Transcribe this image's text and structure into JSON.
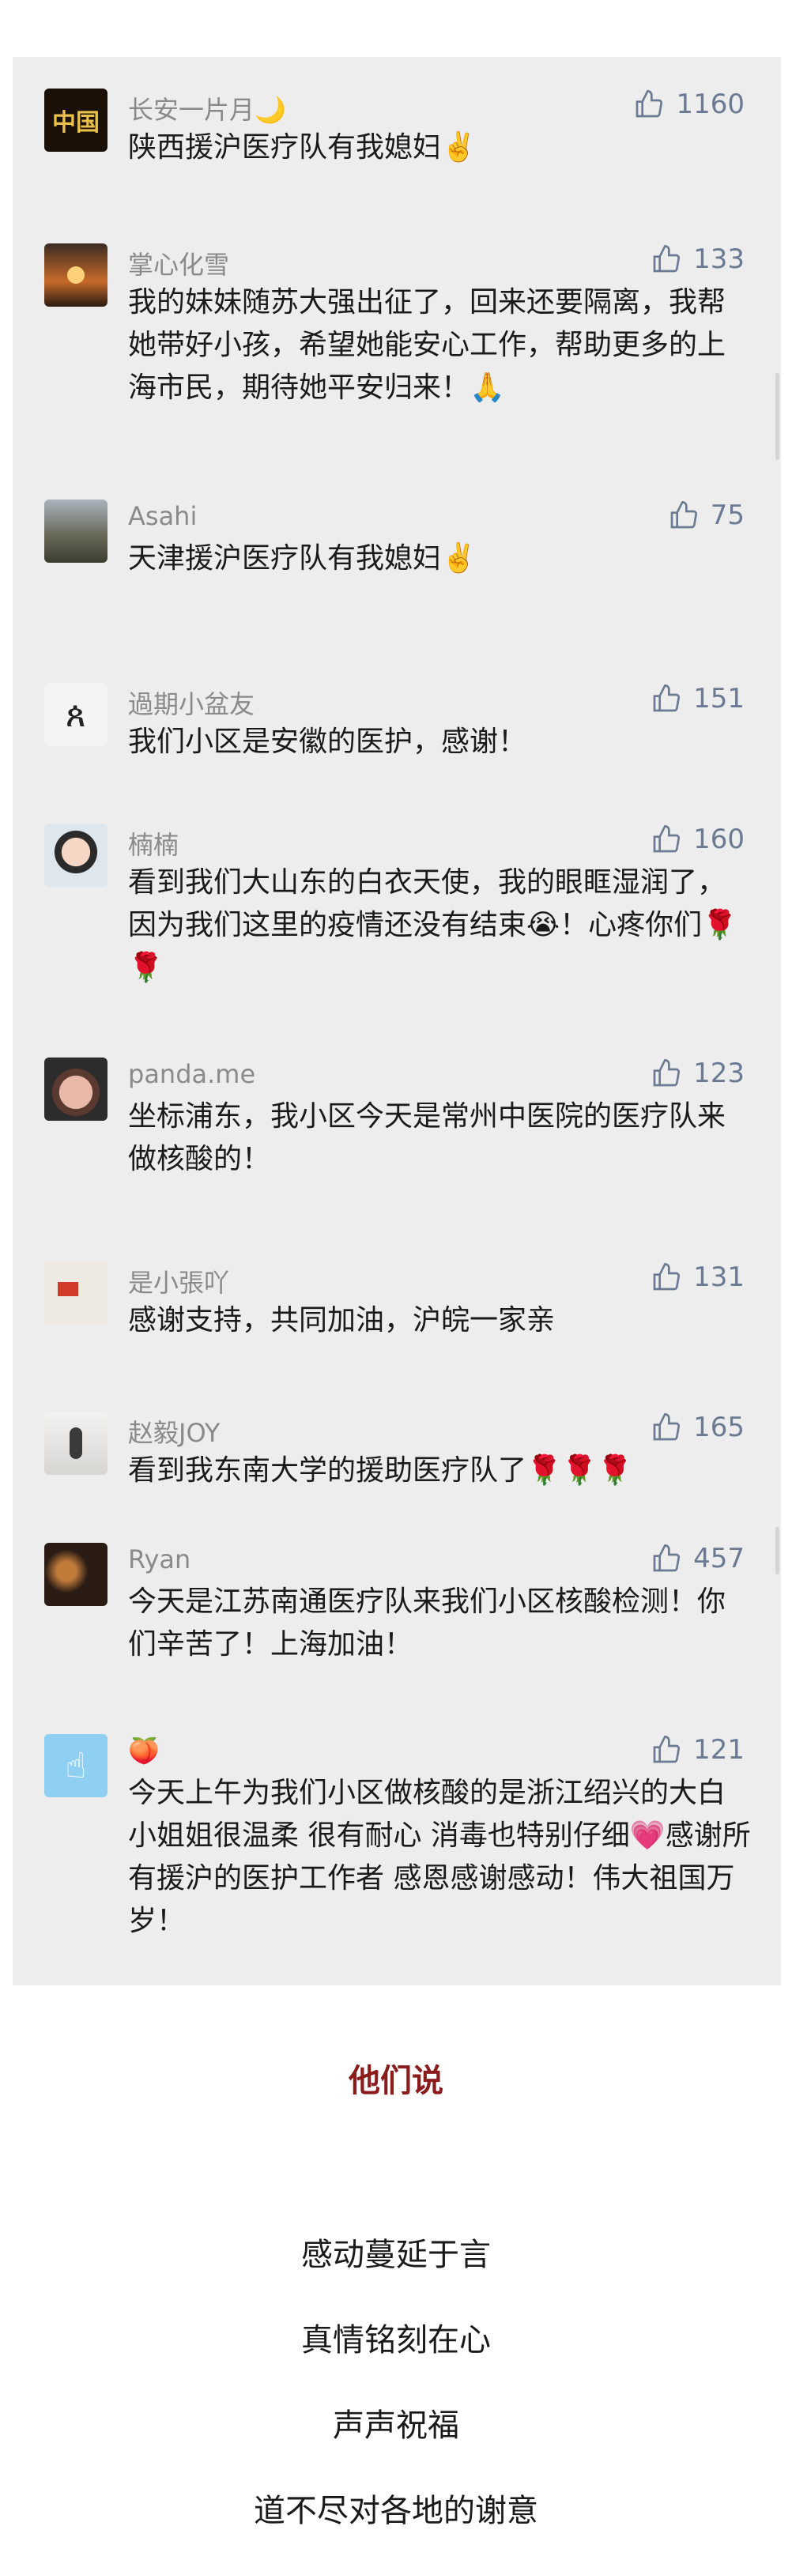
{
  "comments": [
    {
      "user": "长安一片月🌙",
      "likes": "1160",
      "text": "陕西援沪医疗队有我媳妇✌️",
      "avatar_icon": "china-poster-icon"
    },
    {
      "user": "掌心化雪",
      "likes": "133",
      "text": "我的妹妹随苏大强出征了，回来还要隔离，我帮她带好小孩，希望她能安心工作，帮助更多的上海市民，期待她平安归来！🙏",
      "avatar_icon": "sunset-icon"
    },
    {
      "user": "Asahi",
      "likes": "75",
      "text": "天津援沪医疗队有我媳妇✌️",
      "avatar_icon": "building-photo-icon"
    },
    {
      "user": "過期小盆友",
      "likes": "151",
      "text": "我们小区是安徽的医护，感谢！",
      "avatar_icon": "sketch-figure-icon"
    },
    {
      "user": "楠楠",
      "likes": "160",
      "text": "看到我们大山东的白衣天使，我的眼眶湿润了，因为我们这里的疫情还没有结束😭！心疼你们🌹🌹",
      "avatar_icon": "portrait-icon"
    },
    {
      "user": "panda.me",
      "likes": "123",
      "text": "坐标浦东，我小区今天是常州中医院的医疗队来做核酸的！",
      "avatar_icon": "toy-bear-icon"
    },
    {
      "user": "是小張吖",
      "likes": "131",
      "text": "感谢支持，共同加油，沪皖一家亲",
      "avatar_icon": "flag-icon"
    },
    {
      "user": "赵毅JOY",
      "likes": "165",
      "text": "看到我东南大学的援助医疗队了🌹🌹🌹",
      "avatar_icon": "person-sitting-icon"
    },
    {
      "user": "Ryan",
      "likes": "457",
      "text": "今天是江苏南通医疗队来我们小区核酸检测！你们辛苦了！上海加油！",
      "avatar_icon": "dark-photo-icon"
    },
    {
      "user": "🍑",
      "likes": "121",
      "text": "今天上午为我们小区做核酸的是浙江绍兴的大白 小姐姐很温柔 很有耐心 消毒也特别仔细💗感谢所有援沪的医护工作者 感恩感谢感动！伟大祖国万岁！",
      "avatar_icon": "cartoon-icon"
    }
  ],
  "section_title": "他们说",
  "closing_lines": [
    "感动蔓延于言",
    "真情铭刻在心",
    "声声祝福",
    "道不尽对各地的谢意"
  ],
  "colors": {
    "panel_bg": "#ededed",
    "title_red": "#8b1c1c",
    "like_blue": "#6b7a93",
    "username_gray": "#8a8a8a"
  }
}
